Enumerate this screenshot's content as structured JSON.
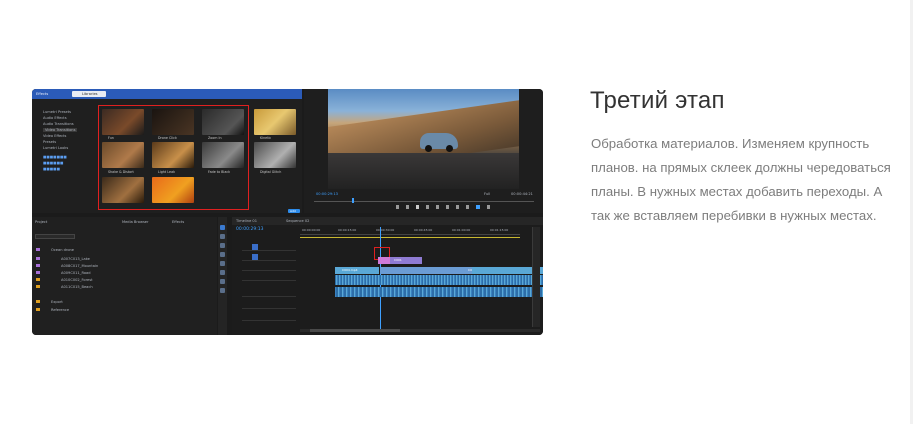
{
  "section": {
    "title": "Третий этап",
    "description": "Обработка материалов. Изменяем крупность планов. на прямых склеек должны чередоваться планы. В нужных местах добавить переходы. А так же вставляем перебивки в нужных местах."
  },
  "editor": {
    "project_tabs": [
      "Effects",
      "Libraries"
    ],
    "effects_tree": [
      "Lumetri Presets",
      "Audio Effects",
      "Audio Transitions",
      "Video Effects",
      "Video Transitions",
      "Presets",
      "Lumetri Looks"
    ],
    "effect_thumbs": [
      "Fun",
      "Drone Click",
      "Zoom In",
      "Kinetic",
      "Shake & Distort",
      "Light Leak",
      "Fade to Black",
      "Digital Glitch"
    ],
    "add_button": "Add",
    "program_timecode": "00:00:29:13",
    "program_fit": "Full",
    "program_duration": "00:00:44:21",
    "project_tabs_bottom": [
      "Project",
      "Media Browser",
      "Effects"
    ],
    "timeline_tabs": [
      "Timeline 01",
      "Sequence 02"
    ],
    "timeline_timecode": "00:00:29:13",
    "timeline_ruler": [
      "00:00:00:00",
      "00:00:15:00",
      "00:00:30:00",
      "00:00:45:00",
      "00:01:00:00",
      "00:01:15:00"
    ],
    "clip_labels": [
      "C001_C003",
      "C001",
      "C004.mp4",
      "C006.mp4"
    ],
    "project_files": [
      "Ocean drone",
      "A007C013_Lake",
      "A008C017_Mountain",
      "A009C011_Road",
      "A010C002_Forest",
      "A011C015_Beach",
      "Export",
      "Reference"
    ],
    "accent": "#2d8ceb",
    "selection_color": "#e02020",
    "clip_color_video": "#8f7bd3",
    "clip_color_audio": "#5aa8d6"
  }
}
